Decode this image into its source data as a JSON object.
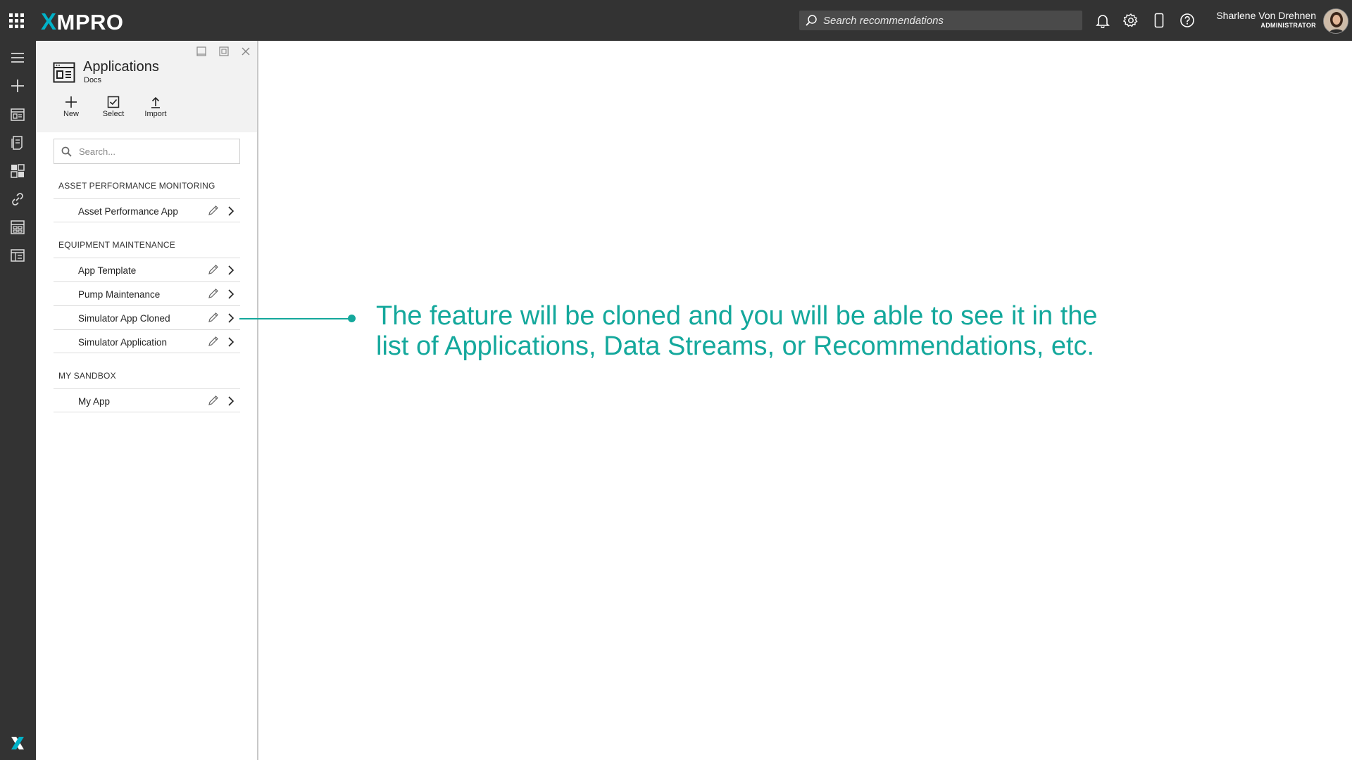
{
  "topbar": {
    "logo_text": "MPRO",
    "logo_x": "X",
    "search_placeholder": "Search recommendations",
    "user_name": "Sharlene Von Drehnen",
    "user_role": "ADMINISTRATOR",
    "icons": [
      "apps-grid-icon",
      "bell-icon",
      "gear-icon",
      "mobile-icon",
      "help-icon"
    ]
  },
  "rail": {
    "items": [
      "menu-icon",
      "add-icon",
      "applications-icon",
      "recommendations-icon",
      "dashboard-icon",
      "integration-link-icon",
      "data-streams-icon",
      "catalog-icon"
    ]
  },
  "panel": {
    "title": "Applications",
    "subtitle": "Docs",
    "actions": [
      {
        "label": "New"
      },
      {
        "label": "Select"
      },
      {
        "label": "Import"
      }
    ],
    "search_placeholder": "Search...",
    "groups": [
      {
        "label": "ASSET PERFORMANCE MONITORING",
        "items": [
          "Asset Performance App"
        ]
      },
      {
        "label": "EQUIPMENT MAINTENANCE",
        "items": [
          "App Template",
          "Pump Maintenance",
          "Simulator App Cloned",
          "Simulator Application"
        ]
      },
      {
        "label": "MY SANDBOX",
        "items": [
          "My App"
        ]
      }
    ]
  },
  "annotation": {
    "line1": "The feature will be cloned and you will be able to see it in the",
    "line2": "list of Applications, Data Streams, or Recommendations, etc."
  },
  "colors": {
    "topbar": "#333333",
    "accent": "#14a89c",
    "logo_x": "#00b2c8"
  }
}
